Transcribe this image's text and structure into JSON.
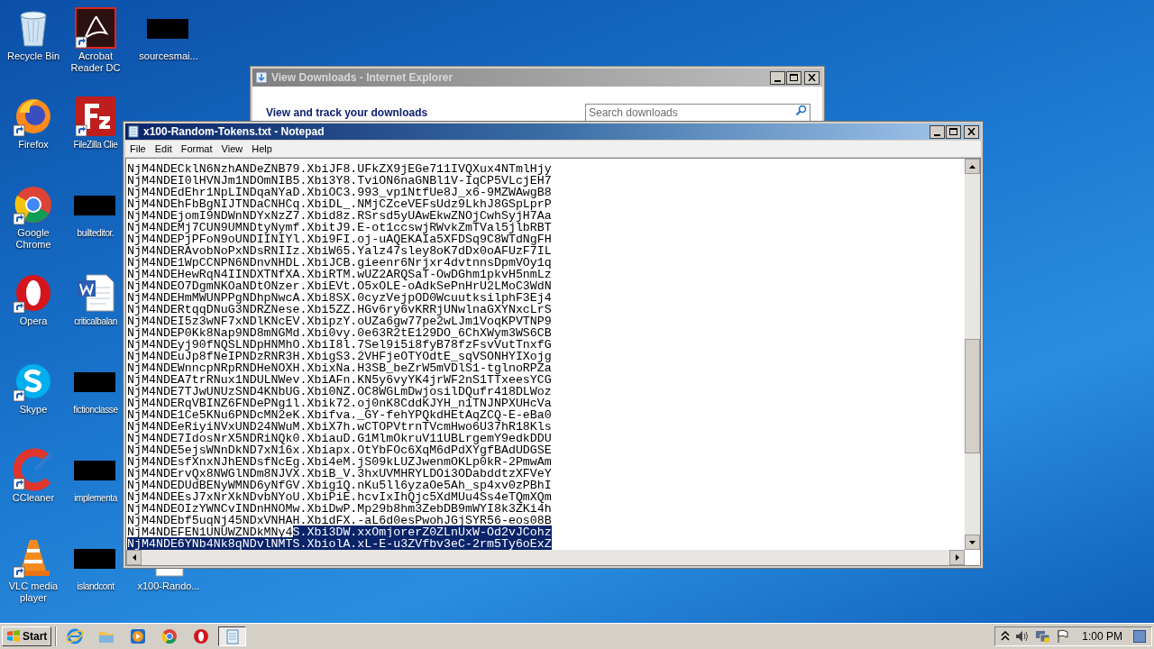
{
  "desktop_rows": [
    [
      {
        "label": "Recycle Bin",
        "kind": "recycle"
      },
      {
        "label": "Acrobat Reader DC",
        "kind": "acrobat"
      },
      {
        "label": "sourcesmai...",
        "kind": "redacted"
      }
    ],
    [
      {
        "label": "Firefox",
        "kind": "firefox"
      },
      {
        "label": "FileZilla Clie",
        "kind": "filezilla"
      }
    ],
    [
      {
        "label": "Google Chrome",
        "kind": "chrome"
      },
      {
        "label": "builteditor.",
        "kind": "redacted"
      }
    ],
    [
      {
        "label": "Opera",
        "kind": "opera"
      },
      {
        "label": "criticalbalan",
        "kind": "word"
      }
    ],
    [
      {
        "label": "Skype",
        "kind": "skype"
      },
      {
        "label": "fictionclasse",
        "kind": "redacted"
      }
    ],
    [
      {
        "label": "CCleaner",
        "kind": "ccleaner"
      },
      {
        "label": "implementa",
        "kind": "redacted"
      }
    ],
    [
      {
        "label": "VLC media player",
        "kind": "vlc"
      },
      {
        "label": "islandcont",
        "kind": "redacted"
      },
      {
        "label": "x100-Rando...",
        "kind": "textfile"
      }
    ]
  ],
  "ie_window": {
    "title": "View Downloads - Internet Explorer",
    "heading": "View and track your downloads",
    "search": {
      "placeholder": "Search downloads"
    }
  },
  "notepad": {
    "title": "x100-Random-Tokens.txt - Notepad",
    "menu": [
      "File",
      "Edit",
      "Format",
      "View",
      "Help"
    ],
    "lines": [
      [
        {
          "text": "NjM4NDECklN6NzhANDeZNB79.XbiJF8.UFkZX9jEGe711IVQXux4NTmlHjy",
          "selected": false
        }
      ],
      [
        {
          "text": "NjM4NDEI0lHVNJm1NDOmNIB5.Xbi3Y8.TviON6naGNBl1V-IqCP5VLcjEH7",
          "selected": false
        }
      ],
      [
        {
          "text": "NjM4NDEdEhr1NpLINDqaNYaD.XbiOC3.993_vp1NtfUe8J_x6-9MZWAwgB8",
          "selected": false
        }
      ],
      [
        {
          "text": "NjM4NDEhFbBgNIJTNDaCNHCq.XbiDL_.NMjCZceVEFsUdz9LkhJ8GSpLprP",
          "selected": false
        }
      ],
      [
        {
          "text": "NjM4NDEjomI9NDWnNDYxNzZ7.Xbid8z.RSrsd5yUAwEkwZNOjCwhSyjH7Aa",
          "selected": false
        }
      ],
      [
        {
          "text": "NjM4NDEMj7CUN9UMNDtyNymf.XbitJ9.E-ot1ccswjRWvkZmTVal5jlbRBT",
          "selected": false
        }
      ],
      [
        {
          "text": "NjM4NDEPjPFoN9oUNDIINIYl.Xbi9FI.oj-uAQEKAIa5XFDSq9C8WTdNgFH",
          "selected": false
        }
      ],
      [
        {
          "text": "NjM4NDERAvobNoPxNDsRNIIz.XbiW65.Yalz47sley8oK7dDx0oAFUzF7IL",
          "selected": false
        }
      ],
      [
        {
          "text": "NjM4NDE1WpCCNPN6NDnvNHDL.XbiJCB.gieenr6Nrjxr4dvtnnsDpmVOy1q",
          "selected": false
        }
      ],
      [
        {
          "text": "NjM4NDEHewRqN4IINDXTNfXA.XbiRTM.wUZ2ARQSaT-OwDGhm1pkvH5nmLz",
          "selected": false
        }
      ],
      [
        {
          "text": "NjM4NDEO7DgmNKOaNDtONzer.XbiEVt.O5xOLE-oAdkSePnHrU2LMoC3WdN",
          "selected": false
        }
      ],
      [
        {
          "text": "NjM4NDEHmMWUNPPgNDhpNwcA.Xbi8SX.0cyzVejpOD0WcuutksilphF3Ej4",
          "selected": false
        }
      ],
      [
        {
          "text": "NjM4NDERtqqDNuG3NDRZNese.Xbi5ZZ.HGv6ry6vKRRjUNwlnaGXYNxcLrS",
          "selected": false
        }
      ],
      [
        {
          "text": "NjM4NDEI5z3wNF7xNDlKNcEV.XbipzY.oUZa6gw77pe2wLJm1VoqKPVTNP9",
          "selected": false
        }
      ],
      [
        {
          "text": "NjM4NDEP0Kk8Nap9ND8mNGMd.Xbi0vy.0e63R2tE129DO_6ChXWym3WS6CB",
          "selected": false
        }
      ],
      [
        {
          "text": "NjM4NDEyj90fNQSLNDpHNMhO.XbiI8l.7Sel9i5i8fyB78fzFsvVutTnxfG",
          "selected": false
        }
      ],
      [
        {
          "text": "NjM4NDEuJp8fNeIPNDzRNR3H.XbigS3.2VHFjeOTYOdtE_sqVSONHYIXojg",
          "selected": false
        }
      ],
      [
        {
          "text": "NjM4NDEWnncpNRpRNDHeNOXH.XbixNa.H3SB_beZrW5mVDlS1-tglnoRPZa",
          "selected": false
        }
      ],
      [
        {
          "text": "NjM4NDEA7trRNux1NDULNWev.XbiAFn.KN5y6vyYK4jrWF2nS1TTxeesYCG",
          "selected": false
        }
      ],
      [
        {
          "text": "NjM4NDE7TJwUNUzSND4KNbUG.Xbi0NZ.OC8WGLmDwjosilDQufr418DLWoz",
          "selected": false
        }
      ],
      [
        {
          "text": "NjM4NDERqVBINZ6FNDePNg1l.Xbik72.oj0nK8CddKJYH_n1TNJNPXUHcVa",
          "selected": false
        }
      ],
      [
        {
          "text": "NjM4NDE1Ce5KNu6PNDcMN2eK.Xbifva._GY-fehYPQkdHEtAqZCQ-E-eBa0",
          "selected": false
        }
      ],
      [
        {
          "text": "NjM4NDEeRiyiNVxUND24NWuM.XbiX7h.wCTOPVtrnTVcmHwo6U37hR18Kls",
          "selected": false
        }
      ],
      [
        {
          "text": "NjM4NDE7IdosNrX5NDRiNQk0.XbiauD.G1MlmOkruV11UBLrgemY9edkDDU",
          "selected": false
        }
      ],
      [
        {
          "text": "NjM4NDE5ejsWNnDkND7xN16x.Xbiapx.OtYbFOc6XqM6dPdXYgfBAdUDGSE",
          "selected": false
        }
      ],
      [
        {
          "text": "NjM4NDEsfXnxNJhENDsfNcEg.Xbi4eM.jS09kLUZJwenmOKLp0kR-2PmwAm",
          "selected": false
        }
      ],
      [
        {
          "text": "NjM4NDErvQx8NWGlNDm8NJVX.XbiB_V.3hxUVMHRYLDOi3ODabddtzXFVeY",
          "selected": false
        }
      ],
      [
        {
          "text": "NjM4NDEDUdBENyWMND6yNfGV.Xbig1Q.nKu5ll6yzaOe5Ah_sp4xv0zPBhI",
          "selected": false
        }
      ],
      [
        {
          "text": "NjM4NDEEsJ7xNrXkNDvbNYoU.XbiPiE.hcvIxIhQjc5XdMUu4Ss4eTQmXQm",
          "selected": false
        }
      ],
      [
        {
          "text": "NjM4NDEOIzYWNCvINDnHNOMw.XbiDwP.Mp29b8hm3ZebDB9mWYI8k3ZKi4h",
          "selected": false
        }
      ],
      [
        {
          "text": "NjM4NDEbf5uqNj45NDxVNHAH.XbidFX.-aL6d0esPwohJGjSYR56-eos08B",
          "selected": false
        }
      ],
      [
        {
          "text": "NjM4NDEFEN1UNUWZNDkMNy4",
          "selected": false
        },
        {
          "text": "S.Xbi3DW.xxOmjorerZ0ZLnUxW-Od2vJCohz",
          "selected": true
        }
      ],
      [
        {
          "text": "NjM4NDE6YNb4Nk8qNDvlNMTS.XbiolA.xL-E-u3ZVfbv3eC-2rm5Ty6oExZ",
          "selected": true
        }
      ]
    ]
  },
  "taskbar": {
    "start": "Start",
    "apps": [
      {
        "kind": "ie",
        "selected": false
      },
      {
        "kind": "explorer",
        "selected": false
      },
      {
        "kind": "media",
        "selected": false
      },
      {
        "kind": "chrome",
        "selected": false
      },
      {
        "kind": "opera",
        "selected": false
      },
      {
        "kind": "notepad",
        "selected": true
      }
    ],
    "clock": "1:00 PM"
  }
}
